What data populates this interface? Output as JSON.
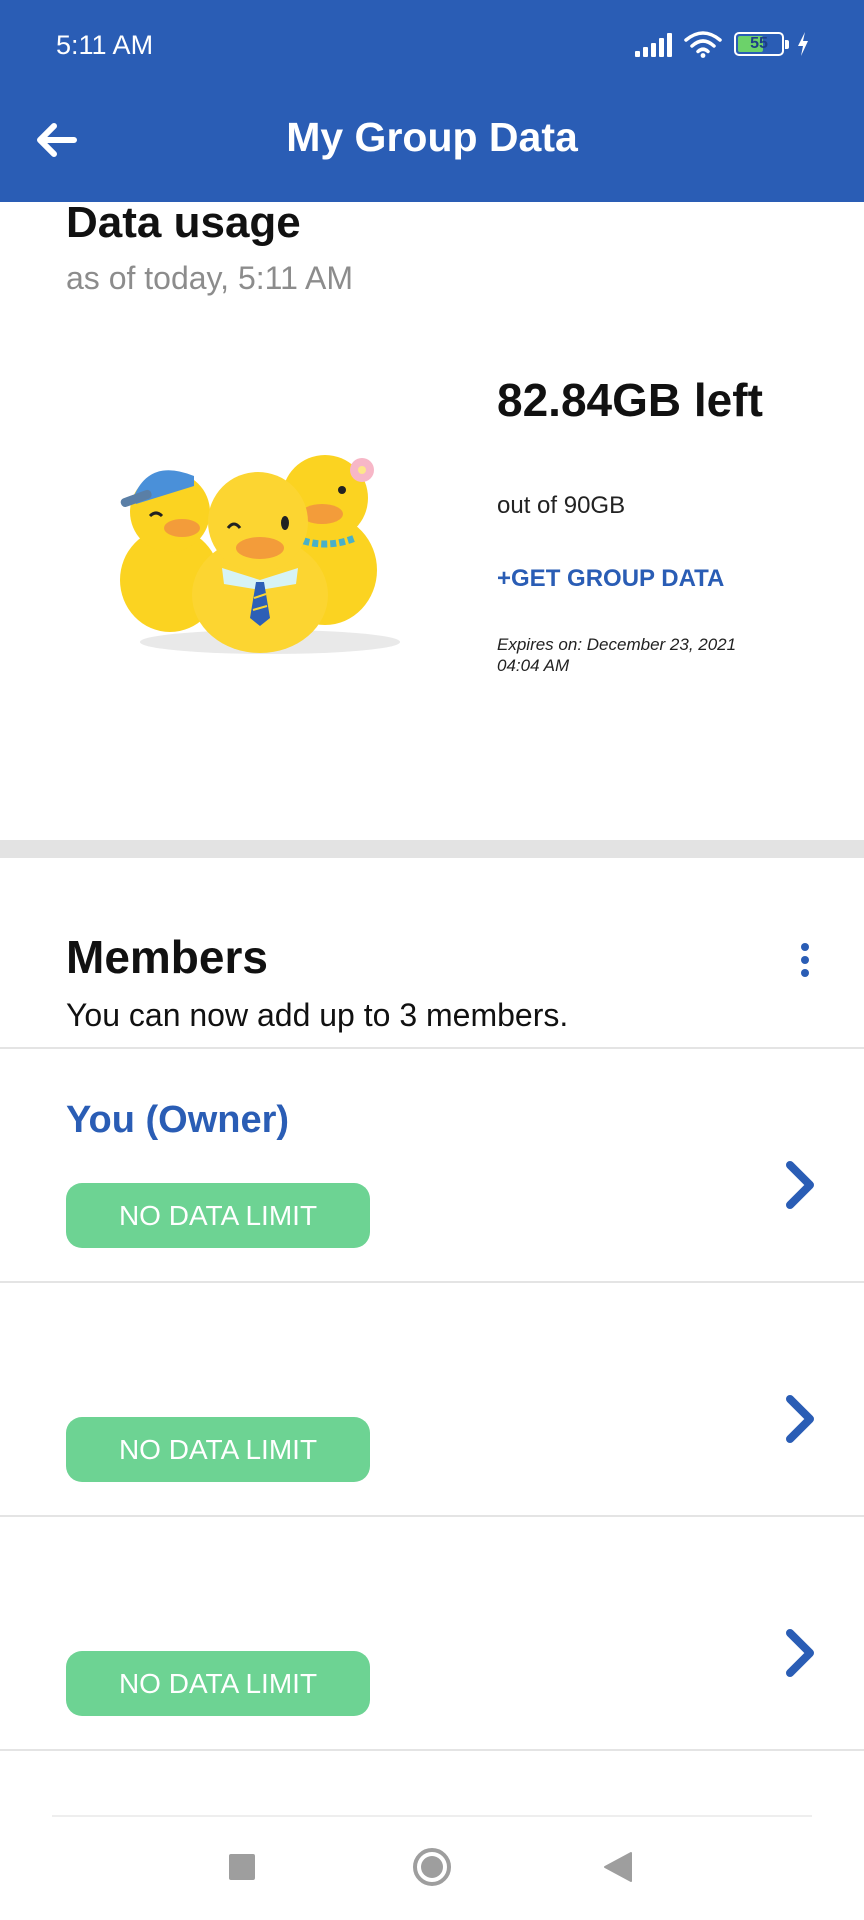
{
  "status_bar": {
    "time": "5:11 AM",
    "battery_level": "55",
    "icons": [
      "signal-icon",
      "wifi-icon",
      "battery-icon",
      "charging-icon"
    ]
  },
  "app_bar": {
    "back_icon": "arrow-left-icon",
    "title": "My Group Data"
  },
  "usage": {
    "title": "Data usage",
    "subtitle": "as of today, 5:11 AM",
    "amount_left": "82.84GB left",
    "out_of": "out of 90GB",
    "get_data_label": "+GET GROUP DATA",
    "expires": "Expires on: December 23, 2021 04:04 AM",
    "illustration": "three-ducks-illustration"
  },
  "members": {
    "title": "Members",
    "subtitle": "You can now add up to 3 members.",
    "more_icon": "more-vertical-icon",
    "list": [
      {
        "name": "You (Owner)",
        "limit": "NO DATA LIMIT"
      },
      {
        "name": "",
        "limit": "NO DATA LIMIT"
      },
      {
        "name": "",
        "limit": "NO DATA LIMIT"
      }
    ]
  },
  "nav_bar": {
    "buttons": [
      "recents-square-icon",
      "home-circle-icon",
      "back-triangle-icon"
    ]
  },
  "colors": {
    "primary": "#2a5db5",
    "badge": "#6dd393",
    "separator": "#e3e3e3"
  }
}
